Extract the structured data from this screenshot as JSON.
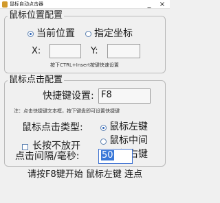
{
  "window": {
    "title": "鼠标自动点击器",
    "minimize_glyph": "_",
    "close_glyph": "×"
  },
  "position_group": {
    "legend": "鼠标位置配置",
    "current_position_label": "当前位置",
    "specified_coords_label": "指定坐标",
    "selected": "current_position",
    "x_label": "X:",
    "x_value": "",
    "y_label": "Y:",
    "y_value": "",
    "hint": "按下CTRL+Insert按键快速设置"
  },
  "click_group": {
    "legend": "鼠标点击配置",
    "hotkey_label": "快捷键设置:",
    "hotkey_value": "F8",
    "hotkey_hint": "注：点击快捷键文本框，按下键盘即可设置快捷键",
    "click_type_label": "鼠标点击类型:",
    "long_press_label": "长按不放开",
    "long_press_checked": false,
    "click_types": [
      "鼠标左键",
      "鼠标中间",
      "鼠标右键"
    ],
    "selected_click_type": "鼠标左键",
    "interval_label": "点击间隔/毫秒:",
    "interval_value": "50"
  },
  "status": {
    "text": "请按F8键开始  鼠标左键  连点"
  },
  "icons": {
    "app_icon": "app-icon",
    "minimize": "minimize-icon",
    "close": "close-icon"
  },
  "colors": {
    "background": "#f0f0f0",
    "accent": "#3a6ed0",
    "selection": "#3a78d8",
    "app_icon": "#d19a2c"
  }
}
